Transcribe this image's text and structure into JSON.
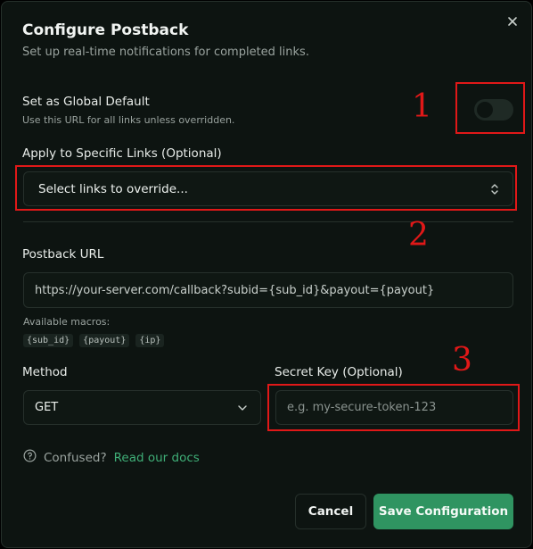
{
  "dialog": {
    "title": "Configure Postback",
    "subtitle": "Set up real-time notifications for completed links."
  },
  "global_default": {
    "label": "Set as Global Default",
    "hint": "Use this URL for all links unless overridden.",
    "enabled": false
  },
  "specific_links": {
    "label": "Apply to Specific Links (Optional)",
    "placeholder": "Select links to override..."
  },
  "postback_url": {
    "label": "Postback URL",
    "value": "https://your-server.com/callback?subid={sub_id}&payout={payout}",
    "macros_label": "Available macros:",
    "macros": [
      "{sub_id}",
      "{payout}",
      "{ip}"
    ]
  },
  "method": {
    "label": "Method",
    "selected": "GET"
  },
  "secret_key": {
    "label": "Secret Key (Optional)",
    "placeholder": "e.g. my-secure-token-123"
  },
  "help": {
    "text": "Confused?",
    "link": "Read our docs"
  },
  "buttons": {
    "cancel": "Cancel",
    "save": "Save Configuration"
  },
  "annotations": [
    "1",
    "2",
    "3"
  ],
  "colors": {
    "accent": "#2f9461",
    "link": "#3fae77",
    "annotation": "#e01818",
    "background": "#0d1411"
  }
}
